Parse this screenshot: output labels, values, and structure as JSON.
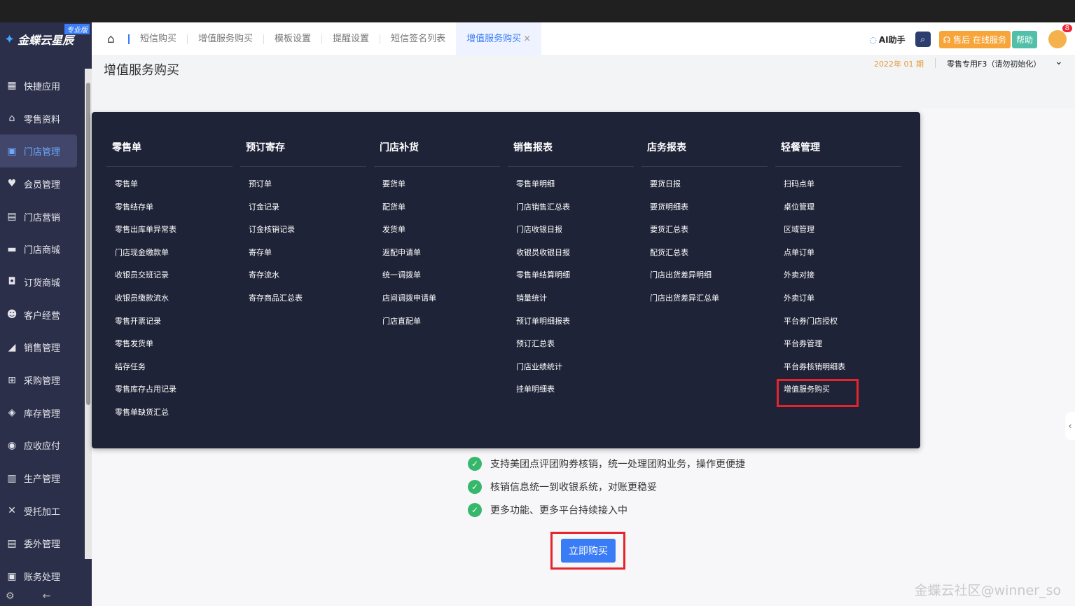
{
  "app": {
    "logo_text": "金蝶云星辰",
    "logo_badge": "专业版"
  },
  "sidebar": {
    "items": [
      {
        "label": "快捷应用",
        "icon": "grid-icon"
      },
      {
        "label": "零售资料",
        "icon": "shop-icon"
      },
      {
        "label": "门店管理",
        "icon": "store-icon",
        "active": true
      },
      {
        "label": "会员管理",
        "icon": "heart-icon"
      },
      {
        "label": "门店营销",
        "icon": "clipboard-icon"
      },
      {
        "label": "门店商城",
        "icon": "mall-icon"
      },
      {
        "label": "订货商城",
        "icon": "bag-icon"
      },
      {
        "label": "客户经营",
        "icon": "user-icon"
      },
      {
        "label": "销售管理",
        "icon": "chart-icon"
      },
      {
        "label": "采购管理",
        "icon": "cart-icon"
      },
      {
        "label": "库存管理",
        "icon": "box-icon"
      },
      {
        "label": "应收应付",
        "icon": "money-icon"
      },
      {
        "label": "生产管理",
        "icon": "factory-icon"
      },
      {
        "label": "受托加工",
        "icon": "tools-icon"
      },
      {
        "label": "委外管理",
        "icon": "doc-icon"
      },
      {
        "label": "账务处理",
        "icon": "ledger-icon"
      }
    ]
  },
  "tabs": [
    "短信购买",
    "增值服务购买",
    "模板设置",
    "提醒设置",
    "短信签名列表"
  ],
  "active_tab": "增值服务购买",
  "tools": {
    "ai": "AI助手",
    "after_sales": "售后 在线服务",
    "help": "帮助",
    "badge_count": "8"
  },
  "page": {
    "title": "增值服务购买",
    "period": "2022年 01 期",
    "shop": "零售专用F3（请勿初始化）"
  },
  "menu": [
    {
      "title": "零售单",
      "items": [
        "零售单",
        "零售结存单",
        "零售出库单异常表",
        "门店现金缴款单",
        "收银员交班记录",
        "收银员缴款流水",
        "零售开票记录",
        "零售发货单",
        "结存任务",
        "零售库存占用记录",
        "零售单缺货汇总"
      ]
    },
    {
      "title": "预订寄存",
      "items": [
        "预订单",
        "订金记录",
        "订金核销记录",
        "寄存单",
        "寄存流水",
        "寄存商品汇总表"
      ]
    },
    {
      "title": "门店补货",
      "items": [
        "要货单",
        "配货单",
        "发货单",
        "返配申请单",
        "统一调拨单",
        "店间调拨申请单",
        "门店直配单"
      ]
    },
    {
      "title": "销售报表",
      "items": [
        "零售单明细",
        "门店销售汇总表",
        "门店收银日报",
        "收银员收银日报",
        "零售单结算明细",
        "销量统计",
        "预订单明细报表",
        "预订汇总表",
        "门店业绩统计",
        "挂单明细表"
      ]
    },
    {
      "title": "店务报表",
      "items": [
        "要货日报",
        "要货明细表",
        "要货汇总表",
        "配货汇总表",
        "门店出货差异明细",
        "门店出货差异汇总单"
      ]
    },
    {
      "title": "轻餐管理",
      "items": [
        "扫码点单",
        "桌位管理",
        "区域管理",
        "点单订单",
        "外卖对接",
        "外卖订单",
        "平台券门店授权",
        "平台券管理",
        "平台券核销明细表",
        "增值服务购买"
      ]
    }
  ],
  "features": [
    "支持美团点评团购券核销，统一处理团购业务，操作更便捷",
    "核销信息统一到收银系统，对账更稳妥",
    "更多功能、更多平台持续接入中"
  ],
  "buy_button": "立即购买",
  "watermark": "金蝶云社区@winner_so"
}
